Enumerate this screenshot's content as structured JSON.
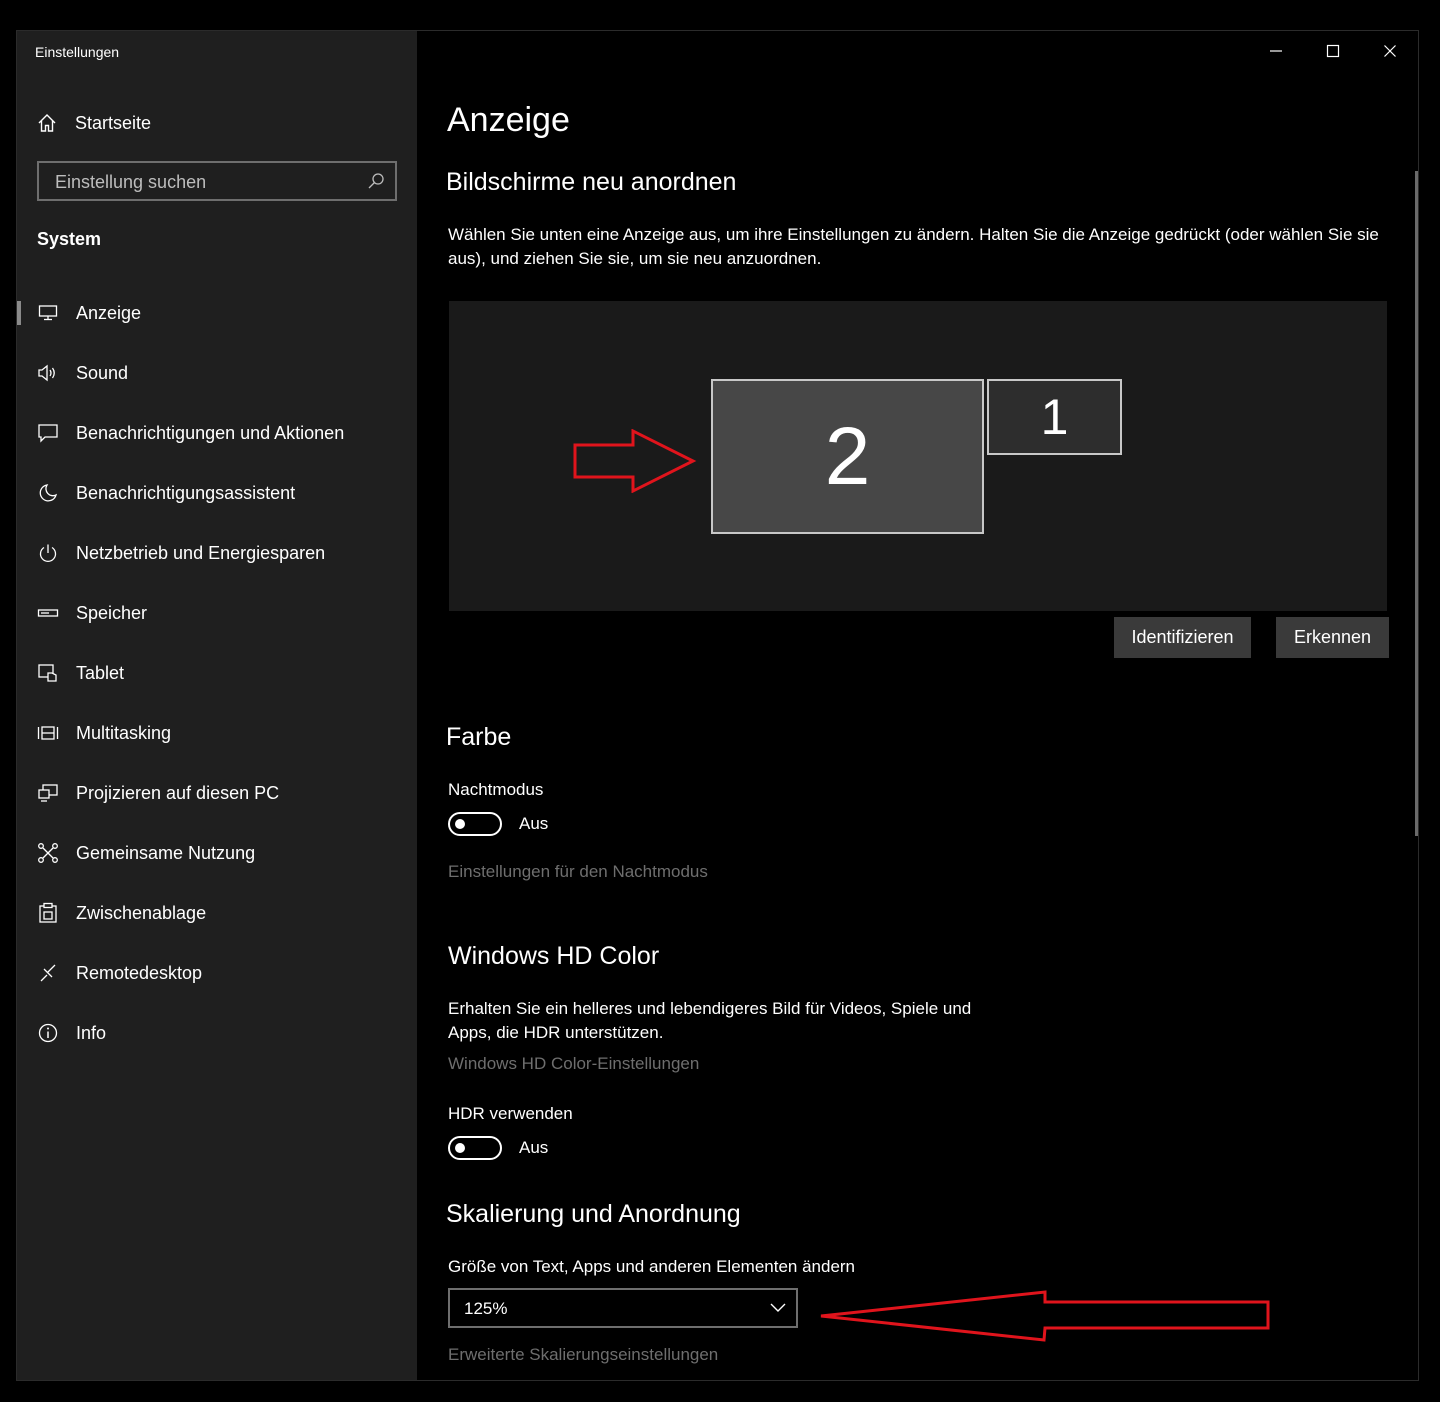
{
  "window": {
    "title": "Einstellungen",
    "controls": {
      "minimize": "minimize-icon",
      "maximize": "maximize-icon",
      "close": "close-icon"
    }
  },
  "sidebar": {
    "home_label": "Startseite",
    "search": {
      "placeholder": "Einstellung suchen",
      "icon": "search-icon"
    },
    "section_title": "System",
    "items": [
      {
        "label": "Anzeige",
        "icon": "monitor-icon",
        "active": true
      },
      {
        "label": "Sound",
        "icon": "speaker-icon"
      },
      {
        "label": "Benachrichtigungen und Aktionen",
        "icon": "notification-icon"
      },
      {
        "label": "Benachrichtigungsassistent",
        "icon": "moon-icon"
      },
      {
        "label": "Netzbetrieb und Energiesparen",
        "icon": "power-icon"
      },
      {
        "label": "Speicher",
        "icon": "storage-icon"
      },
      {
        "label": "Tablet",
        "icon": "tablet-icon"
      },
      {
        "label": "Multitasking",
        "icon": "multitasking-icon"
      },
      {
        "label": "Projizieren auf diesen PC",
        "icon": "project-icon"
      },
      {
        "label": "Gemeinsame Nutzung",
        "icon": "share-icon"
      },
      {
        "label": "Zwischenablage",
        "icon": "clipboard-icon"
      },
      {
        "label": "Remotedesktop",
        "icon": "remote-desktop-icon"
      },
      {
        "label": "Info",
        "icon": "info-icon"
      }
    ]
  },
  "main": {
    "title": "Anzeige",
    "arrange": {
      "heading": "Bildschirme neu anordnen",
      "description": "Wählen Sie unten eine Anzeige aus, um ihre Einstellungen zu ändern. Halten Sie die Anzeige gedrückt (oder wählen Sie sie aus), und ziehen Sie sie, um sie neu anzuordnen.",
      "monitors": [
        "2",
        "1"
      ],
      "identify_button": "Identifizieren",
      "detect_button": "Erkennen"
    },
    "color": {
      "heading": "Farbe",
      "night_mode_label": "Nachtmodus",
      "night_mode_state": "Aus",
      "night_mode_link": "Einstellungen für den Nachtmodus"
    },
    "hdr": {
      "heading": "Windows HD Color",
      "description": "Erhalten Sie ein helleres und lebendigeres Bild für Videos, Spiele und Apps, die HDR unterstützen.",
      "settings_link": "Windows HD Color-Einstellungen",
      "use_hdr_label": "HDR verwenden",
      "use_hdr_state": "Aus"
    },
    "scale": {
      "heading": "Skalierung und Anordnung",
      "size_label": "Größe von Text, Apps und anderen Elementen ändern",
      "size_value": "125%",
      "advanced_link": "Erweiterte Skalierungseinstellungen"
    }
  },
  "colors": {
    "annotation_arrow": "#e0141c",
    "sidebar_bg": "#1f1f1f",
    "main_bg": "#000000"
  }
}
